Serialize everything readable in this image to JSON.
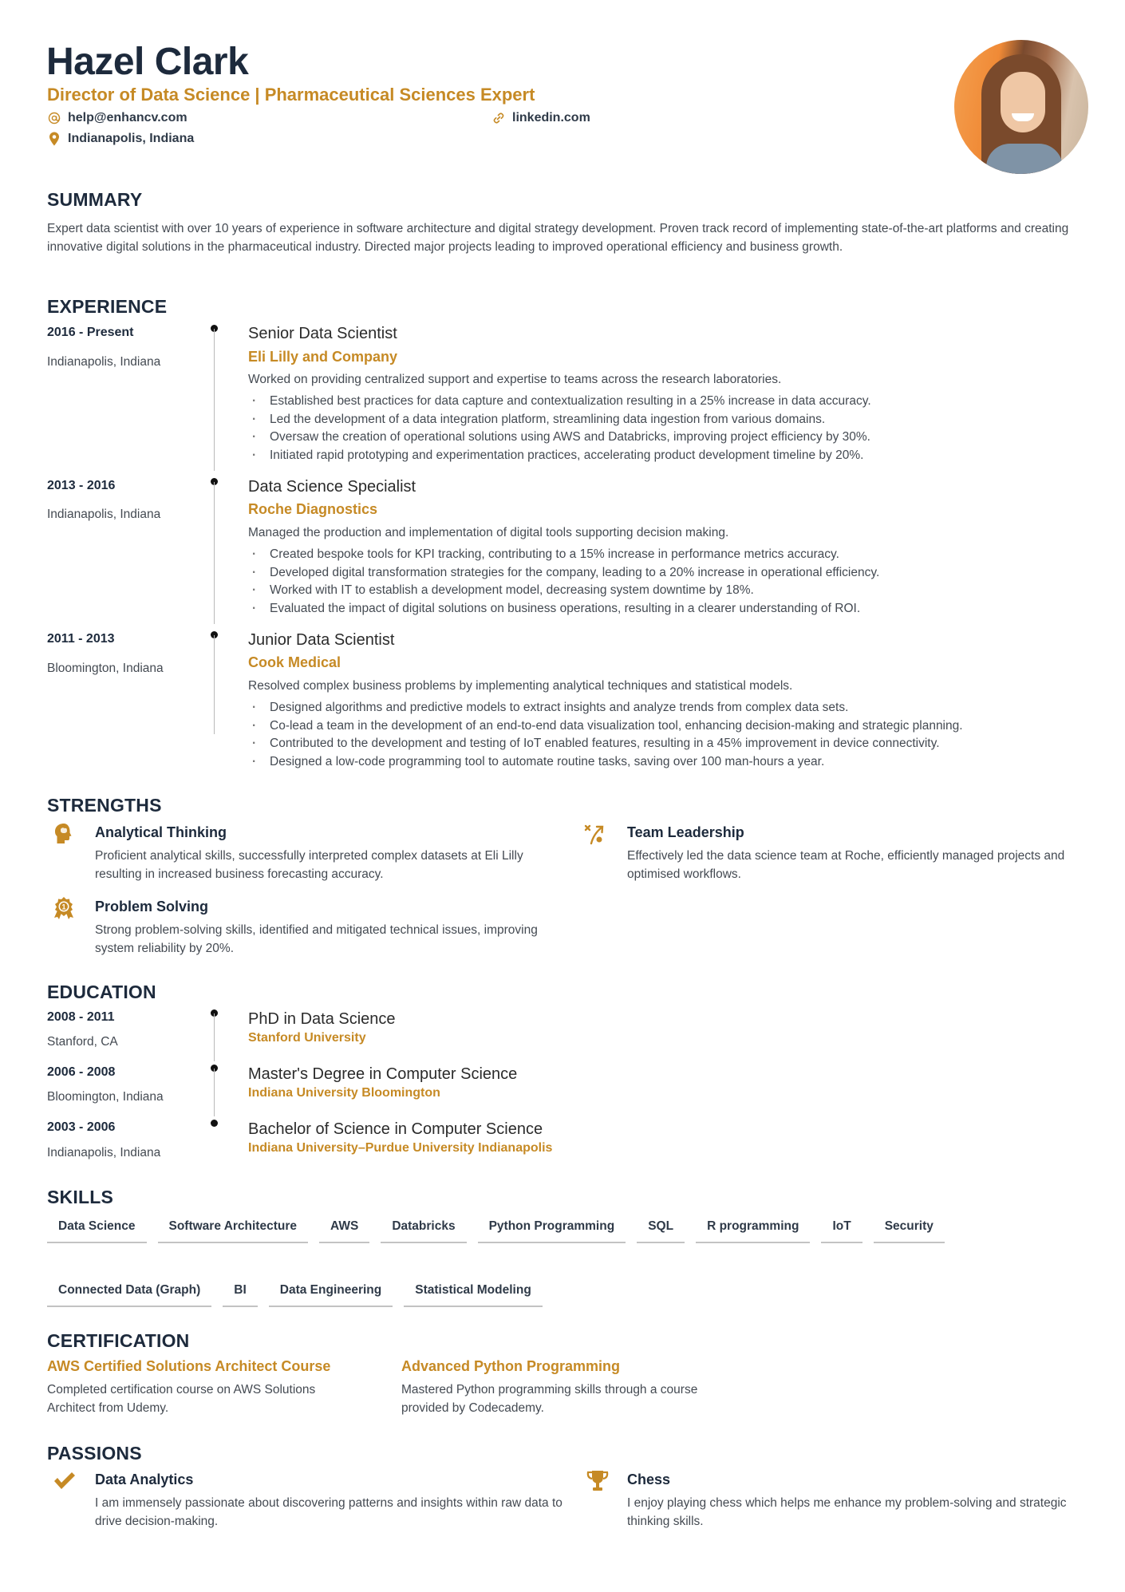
{
  "header": {
    "name": "Hazel Clark",
    "title": "Director of Data Science | Pharmaceutical Sciences Expert",
    "email": "help@enhancv.com",
    "link": "linkedin.com",
    "location": "Indianapolis, Indiana",
    "email_icon": "at-icon",
    "link_icon": "link-icon",
    "location_icon": "map-pin-icon",
    "accent_color": "#c68a25",
    "heading_color": "#1d2a3c"
  },
  "summary": {
    "heading": "SUMMARY",
    "text": "Expert data scientist with over 10 years of experience in software architecture and digital strategy development. Proven track record of implementing state-of-the-art platforms and creating innovative digital solutions in the pharmaceutical industry. Directed major projects leading to improved operational efficiency and business growth."
  },
  "experience": {
    "heading": "EXPERIENCE",
    "items": [
      {
        "dates": "2016 - Present",
        "location": "Indianapolis, Indiana",
        "role": "Senior Data Scientist",
        "company": "Eli Lilly and Company",
        "description": "Worked on providing centralized support and expertise to teams across the research laboratories.",
        "bullets": [
          "Established best practices for data capture and contextualization resulting in a 25% increase in data accuracy.",
          "Led the development of a data integration platform, streamlining data ingestion from various domains.",
          "Oversaw the creation of operational solutions using AWS and Databricks, improving project efficiency by 30%.",
          "Initiated rapid prototyping and experimentation practices, accelerating product development timeline by 20%."
        ]
      },
      {
        "dates": "2013 - 2016",
        "location": "Indianapolis, Indiana",
        "role": "Data Science Specialist",
        "company": "Roche Diagnostics",
        "description": "Managed the production and implementation of digital tools supporting decision making.",
        "bullets": [
          "Created bespoke tools for KPI tracking, contributing to a 15% increase in performance metrics accuracy.",
          "Developed digital transformation strategies for the company, leading to a 20% increase in operational efficiency.",
          "Worked with IT to establish a development model, decreasing system downtime by 18%.",
          "Evaluated the impact of digital solutions on business operations, resulting in a clearer understanding of ROI."
        ]
      },
      {
        "dates": "2011 - 2013",
        "location": "Bloomington, Indiana",
        "role": "Junior Data Scientist",
        "company": "Cook Medical",
        "description": "Resolved complex business problems by implementing analytical techniques and statistical models.",
        "bullets": [
          "Designed algorithms and predictive models to extract insights and analyze trends from complex data sets.",
          "Co-lead a team in the development of an end-to-end data visualization tool, enhancing decision-making and strategic planning.",
          "Contributed to the development and testing of IoT enabled features, resulting in a 45% improvement in device connectivity.",
          "Designed a low-code programming tool to automate routine tasks, saving over 100 man-hours a year."
        ]
      }
    ]
  },
  "strengths": {
    "heading": "STRENGTHS",
    "items": [
      {
        "icon": "brain-head-icon",
        "title": "Analytical Thinking",
        "text": "Proficient analytical skills, successfully interpreted complex datasets at Eli Lilly resulting in increased business forecasting accuracy."
      },
      {
        "icon": "strategy-play-icon",
        "title": "Team Leadership",
        "text": "Effectively led the data science team at Roche, efficiently managed projects and optimised workflows."
      },
      {
        "icon": "award-ribbon-icon",
        "title": "Problem Solving",
        "text": "Strong problem-solving skills, identified and mitigated technical issues, improving system reliability by 20%."
      }
    ]
  },
  "education": {
    "heading": "EDUCATION",
    "items": [
      {
        "dates": "2008 - 2011",
        "location": "Stanford, CA",
        "degree": "PhD in Data Science",
        "school": "Stanford University"
      },
      {
        "dates": "2006 - 2008",
        "location": "Bloomington, Indiana",
        "degree": "Master's Degree in Computer Science",
        "school": "Indiana University Bloomington"
      },
      {
        "dates": "2003 - 2006",
        "location": "Indianapolis, Indiana",
        "degree": "Bachelor of Science in Computer Science",
        "school": "Indiana University–Purdue University Indianapolis"
      }
    ]
  },
  "skills": {
    "heading": "SKILLS",
    "items": [
      "Data Science",
      "Software Architecture",
      "AWS",
      "Databricks",
      "Python Programming",
      "SQL",
      "R programming",
      "IoT",
      "Security",
      "Connected Data (Graph)",
      "BI",
      "Data Engineering",
      "Statistical Modeling"
    ]
  },
  "certification": {
    "heading": "CERTIFICATION",
    "items": [
      {
        "title": "AWS Certified Solutions Architect Course",
        "text": "Completed certification course on AWS Solutions Architect from Udemy."
      },
      {
        "title": "Advanced Python Programming",
        "text": "Mastered Python programming skills through a course provided by Codecademy."
      }
    ]
  },
  "passions": {
    "heading": "PASSIONS",
    "items": [
      {
        "icon": "checkmark-icon",
        "title": "Data Analytics",
        "text": "I am immensely passionate about discovering patterns and insights within raw data to drive decision-making."
      },
      {
        "icon": "trophy-icon",
        "title": "Chess",
        "text": "I enjoy playing chess which helps me enhance my problem-solving and strategic thinking skills."
      }
    ]
  }
}
